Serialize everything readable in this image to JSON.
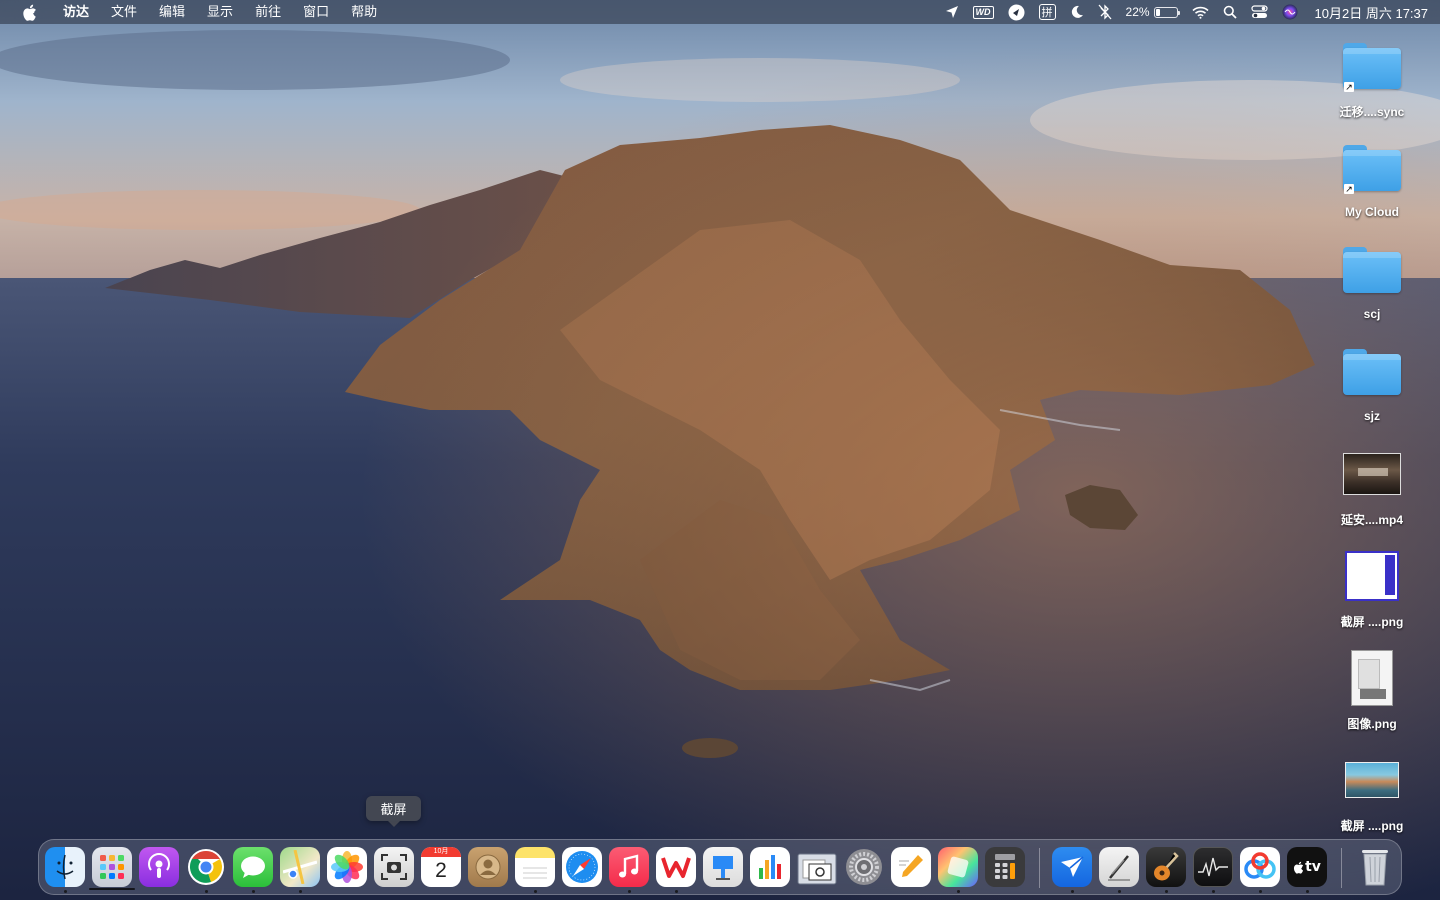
{
  "menubar": {
    "app_name": "访达",
    "menus": [
      "文件",
      "编辑",
      "显示",
      "前往",
      "窗口",
      "帮助"
    ],
    "battery_percent": "22%",
    "battery_level": 0.22,
    "clock": "10月2日 周六 17:37",
    "status_items": {
      "wd_label": "WD",
      "input_method": "拼"
    }
  },
  "desktop": {
    "items": [
      {
        "label": "迁移....sync",
        "kind": "folder-alias"
      },
      {
        "label": "My Cloud",
        "kind": "folder-alias"
      },
      {
        "label": "scj",
        "kind": "folder"
      },
      {
        "label": "sjz",
        "kind": "folder"
      },
      {
        "label": "延安....mp4",
        "kind": "video"
      },
      {
        "label": "截屏 ....png",
        "kind": "image"
      },
      {
        "label": "图像.png",
        "kind": "image"
      },
      {
        "label": "截屏 ....png",
        "kind": "image"
      }
    ]
  },
  "tooltip": {
    "text": "截屏"
  },
  "dock": {
    "apps": [
      {
        "name": "finder-app",
        "running": true
      },
      {
        "name": "launchpad-app",
        "running": false
      },
      {
        "name": "podcasts-app",
        "running": false
      },
      {
        "name": "chrome-app",
        "running": true
      },
      {
        "name": "messages-app",
        "running": true
      },
      {
        "name": "maps-app",
        "running": true
      },
      {
        "name": "photos-app",
        "running": false
      },
      {
        "name": "screenshot-app",
        "running": false
      },
      {
        "name": "calendar-app",
        "running": false
      },
      {
        "name": "contacts-app",
        "running": false
      },
      {
        "name": "notes-app",
        "running": true
      },
      {
        "name": "safari-app",
        "running": false
      },
      {
        "name": "music-app",
        "running": true
      },
      {
        "name": "wps-app",
        "running": true
      },
      {
        "name": "keynote-app",
        "running": false
      },
      {
        "name": "numbers-app",
        "running": false
      },
      {
        "name": "preview-app",
        "running": false
      },
      {
        "name": "system-preferences-app",
        "running": false
      },
      {
        "name": "pages-app",
        "running": false
      },
      {
        "name": "color-app",
        "running": true
      },
      {
        "name": "calculator-app",
        "running": false
      },
      {
        "name": "feishu-app",
        "running": true
      },
      {
        "name": "script-editor-app",
        "running": true
      },
      {
        "name": "garageband-app",
        "running": true
      },
      {
        "name": "activity-monitor-app",
        "running": true
      },
      {
        "name": "baidu-netdisk-app",
        "running": true
      },
      {
        "name": "apple-tv-app",
        "running": true
      },
      {
        "name": "trash",
        "running": false
      }
    ],
    "calendar": {
      "month": "10月",
      "day": "2"
    },
    "appletv_label": "tv"
  },
  "colors": {
    "menubar_bg": "#282e3c",
    "folder_blue": "#4fa8e8",
    "sky": "#8ea6c4",
    "sea": "#25304d"
  }
}
